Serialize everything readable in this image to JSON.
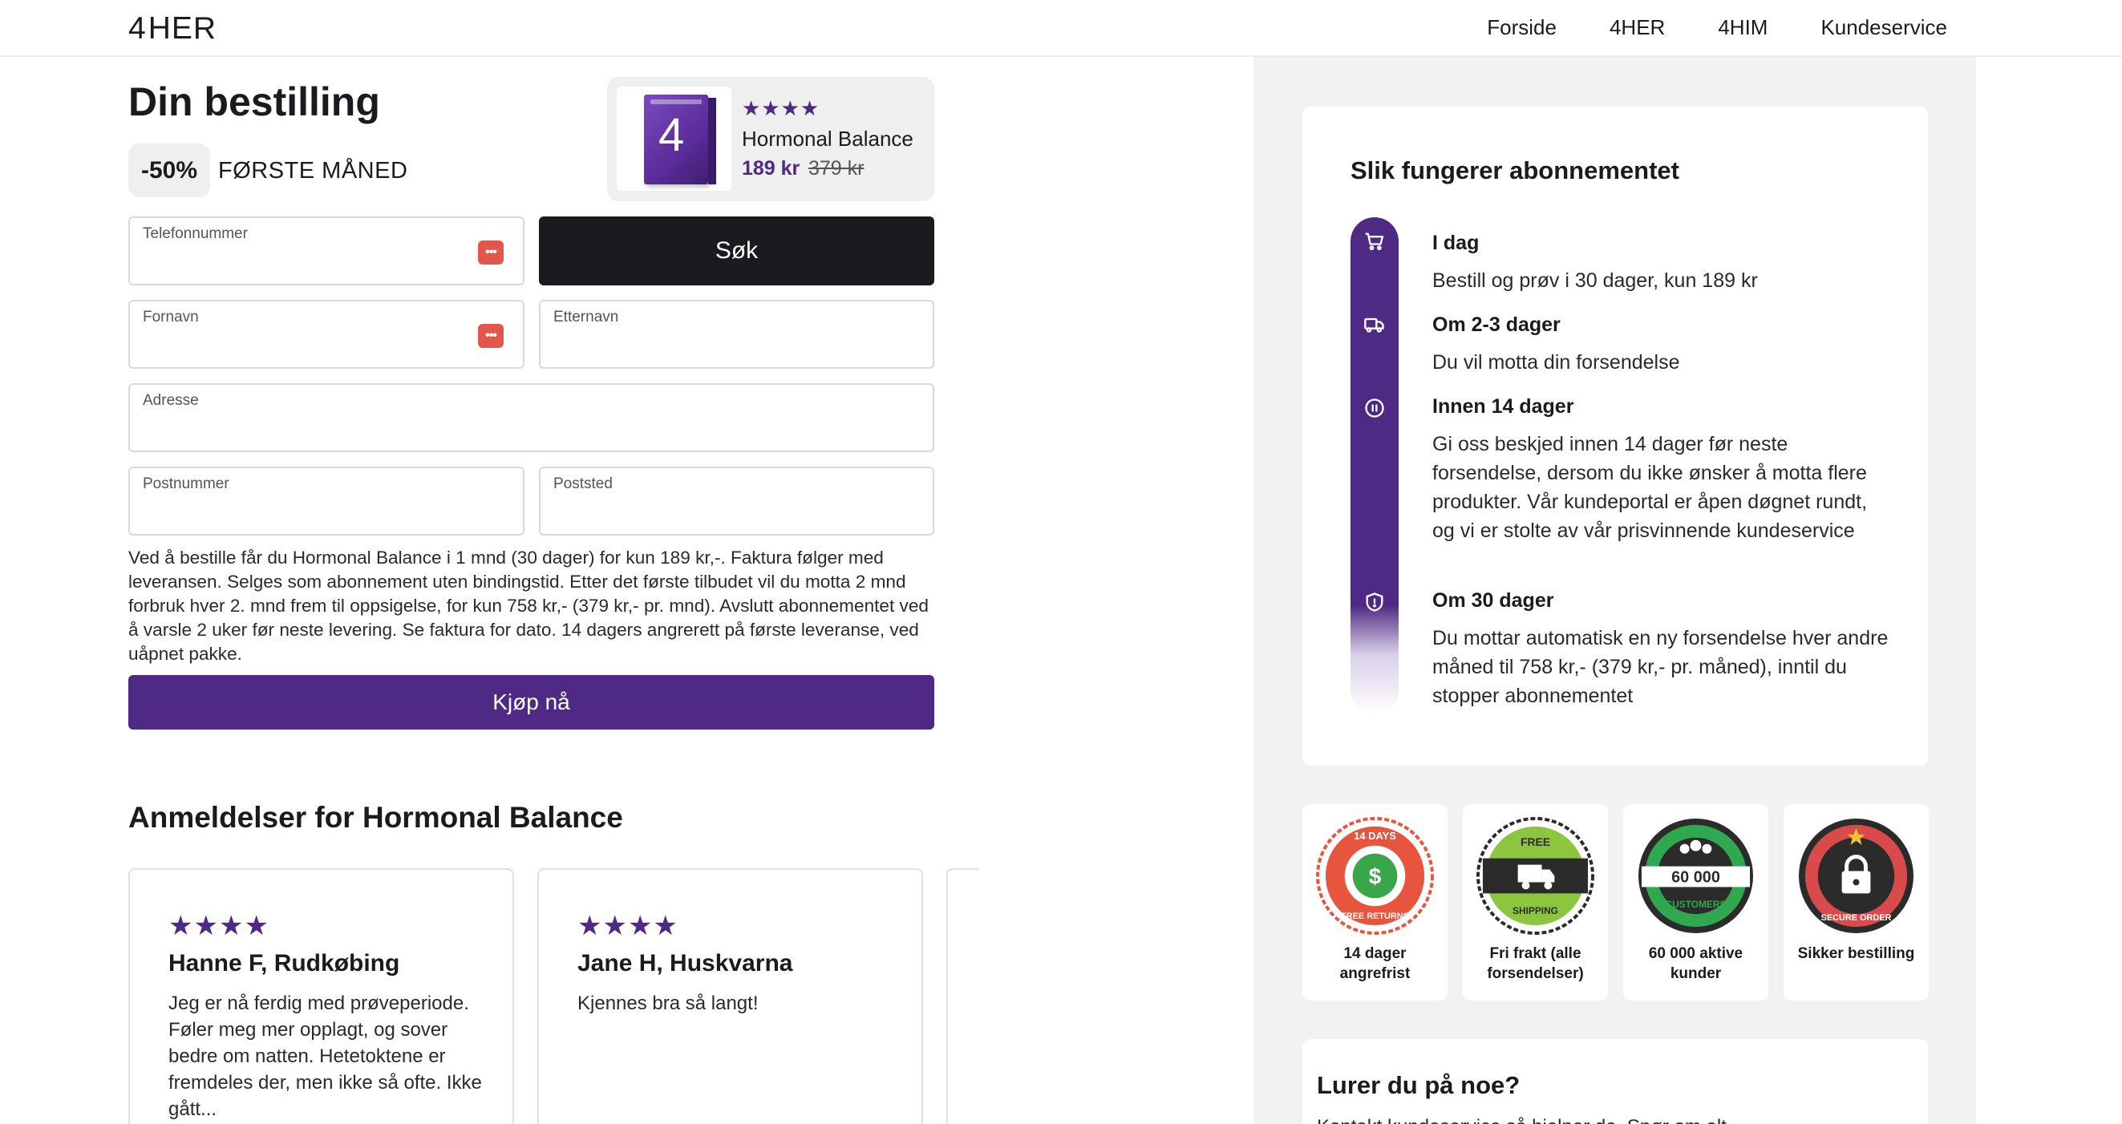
{
  "header": {
    "logo_four": "4",
    "logo_text": "HER",
    "nav": [
      "Forside",
      "4HER",
      "4HIM",
      "Kundeservice"
    ]
  },
  "order": {
    "title": "Din bestilling",
    "discount": "-50%",
    "discount_label": "FØRSTE MÅNED"
  },
  "product": {
    "stars": "★★★★",
    "name": "Hormonal Balance",
    "price_now": "189 kr",
    "price_old": "379 kr",
    "box_label": "4"
  },
  "form": {
    "phone_label": "Telefonnummer",
    "search_button": "Søk",
    "firstname_label": "Fornavn",
    "lastname_label": "Etternavn",
    "address_label": "Adresse",
    "postcode_label": "Postnummer",
    "city_label": "Poststed",
    "autofill_icon": "•••"
  },
  "terms": "Ved å bestille får du Hormonal Balance i 1 mnd (30 dager) for kun 189 kr,-. Faktura følger med leveransen. Selges som abonnement uten bindingstid. Etter det første tilbudet vil du motta 2 mnd forbruk hver 2. mnd frem til oppsigelse, for kun 758 kr,- (379 kr,- pr. mnd). Avslutt abonnementet ved å varsle 2 uker før neste levering. Se faktura for dato. 14 dagers angrerett på første leveranse, ved uåpnet pakke.",
  "buy_button": "Kjøp nå",
  "reviews": {
    "title": "Anmeldelser for Hormonal Balance",
    "items": [
      {
        "stars": "★★★★",
        "name": "Hanne F, Rudkøbing",
        "text": "Jeg er nå ferdig med prøveperiode. Føler meg mer opplagt, og sover bedre om natten. Hetetoktene er fremdeles der, men ikke så ofte. Ikke gått..."
      },
      {
        "stars": "★★★★",
        "name": "Jane H, Huskvarna",
        "text": "Kjennes bra så langt!"
      }
    ]
  },
  "how": {
    "title": "Slik fungerer abonnementet",
    "steps": [
      {
        "icon": "cart-icon",
        "title": "I dag",
        "text": "Bestill og prøv i 30 dager, kun 189 kr"
      },
      {
        "icon": "truck-icon",
        "title": "Om 2-3 dager",
        "text": "Du vil motta din forsendelse"
      },
      {
        "icon": "pause-icon",
        "title": "Innen 14 dager",
        "text": "Gi oss beskjed innen 14 dager før neste forsendelse, dersom du ikke ønsker å motta flere produkter. Vår kundeportal er åpen døgnet rundt, og vi er stolte av vår prisvinnende kundeservice"
      },
      {
        "icon": "shield-icon",
        "title": "Om 30 dager",
        "text": "Du mottar automatisk en ny forsendelse hver andre måned til 758 kr,- (379 kr,- pr. måned), inntil du stopper abonnementet"
      }
    ]
  },
  "badges": [
    {
      "icon": "free-returns-seal-icon",
      "label": "14 dager angrefrist",
      "seal_top": "14 DAYS",
      "seal_bottom": "FREE RETURNS",
      "color": "#e8553f"
    },
    {
      "icon": "free-shipping-seal-icon",
      "label": "Fri frakt (alle forsendelser)",
      "seal_top": "FREE",
      "seal_bottom": "SHIPPING",
      "color": "#8cc63f"
    },
    {
      "icon": "customers-seal-icon",
      "label": "60 000 aktive kunder",
      "seal_top": "60 000",
      "seal_bottom": "CUSTOMERS",
      "color": "#2fa84f"
    },
    {
      "icon": "secure-order-seal-icon",
      "label": "Sikker bestilling",
      "seal_top": "",
      "seal_bottom": "SECURE ORDER",
      "color": "#d94a4a"
    }
  ],
  "question": {
    "title": "Lurer du på noe?",
    "text": "Kontakt kundeservice så hjelper de. Spør om alt."
  },
  "colors": {
    "accent": "#4e2a84",
    "dark_button": "#1b1b1f",
    "panel_bg": "#f2f2f2"
  }
}
